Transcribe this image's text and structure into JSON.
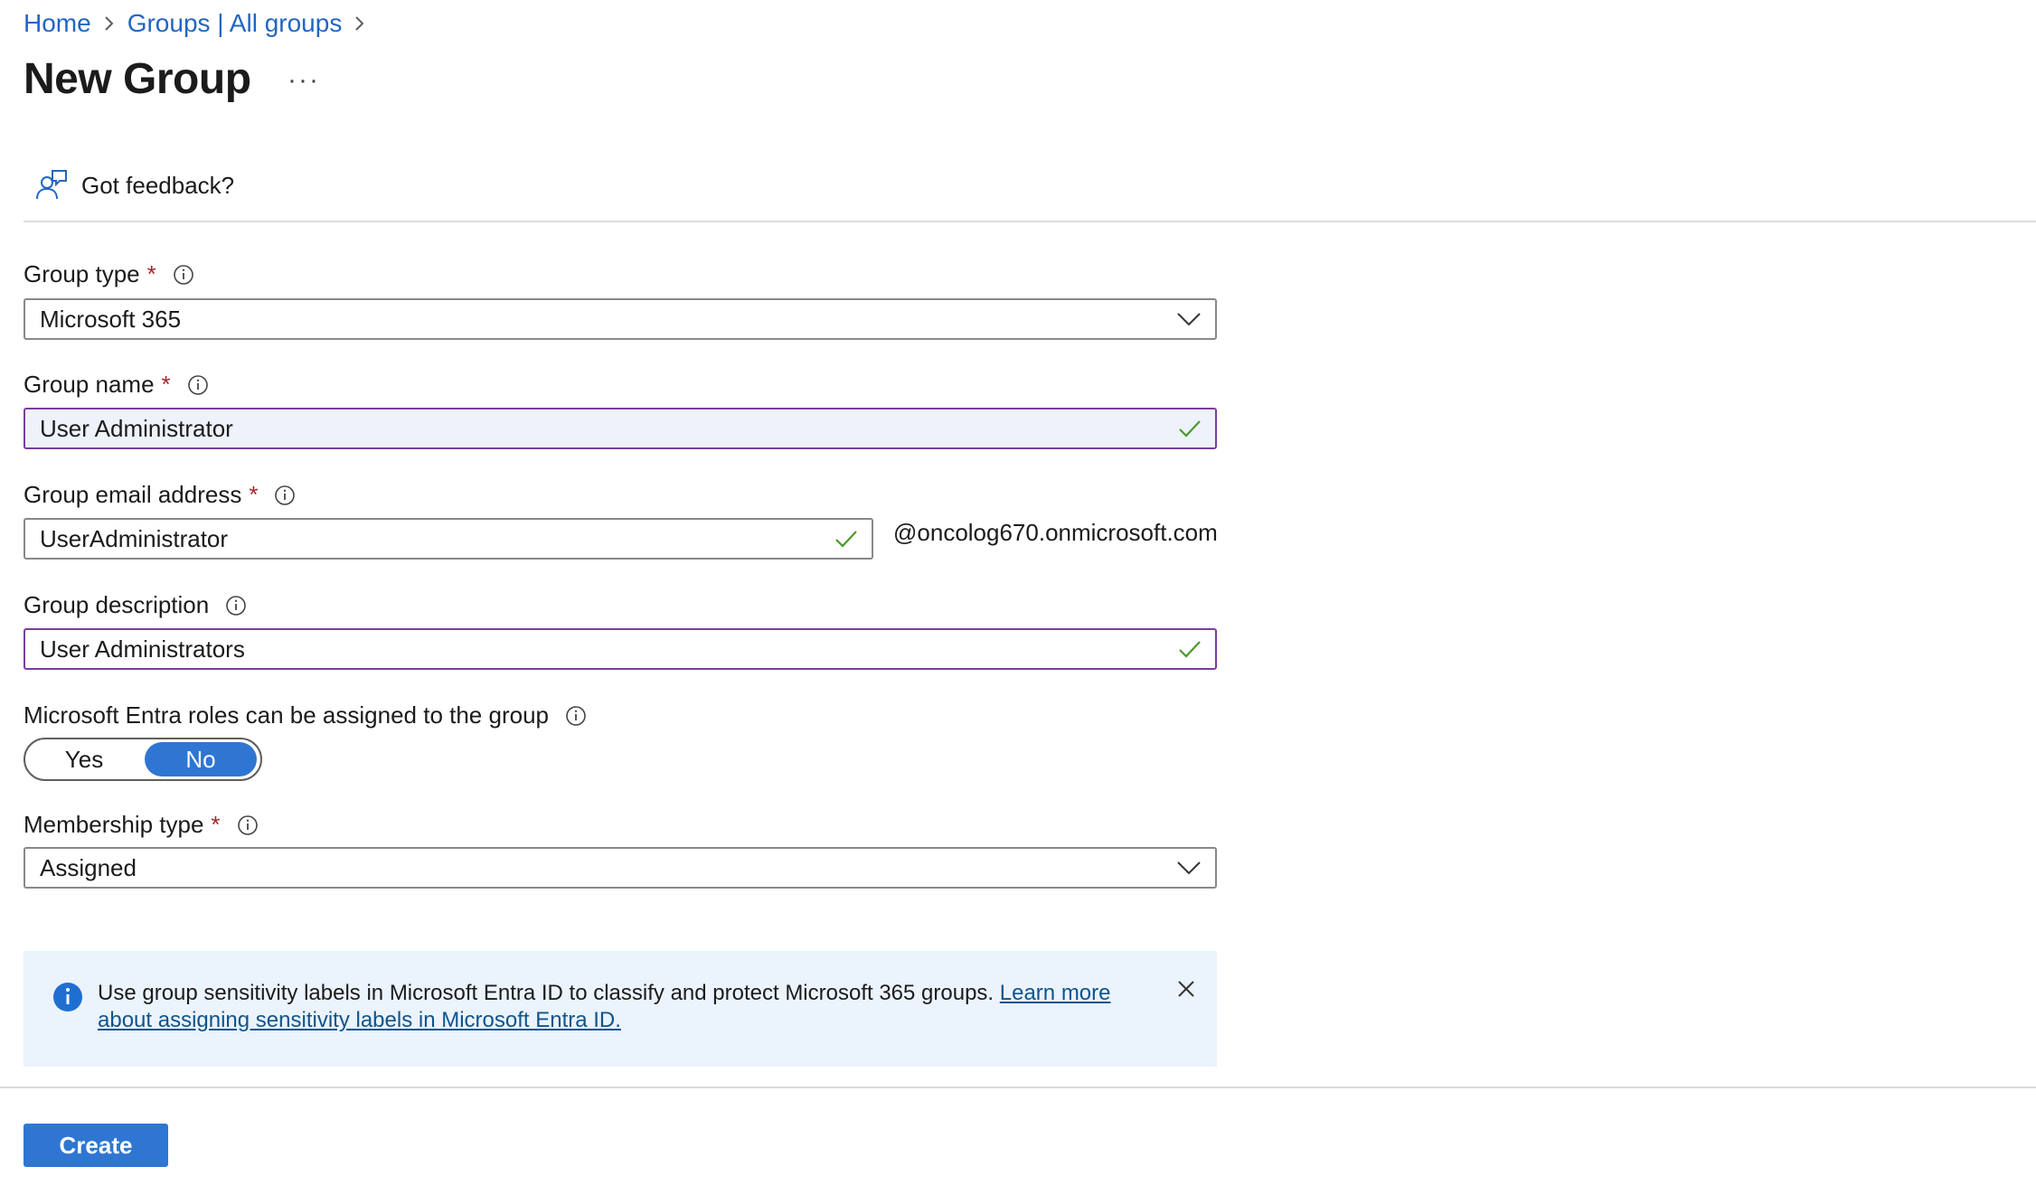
{
  "breadcrumb": {
    "home": "Home",
    "groups": "Groups | All groups"
  },
  "page": {
    "title": "New Group",
    "more": "···"
  },
  "toolbar": {
    "feedback": "Got feedback?"
  },
  "form": {
    "group_type": {
      "label": "Group type",
      "required": "*",
      "value": "Microsoft 365"
    },
    "group_name": {
      "label": "Group name",
      "required": "*",
      "value": "User Administrator"
    },
    "group_email": {
      "label": "Group email address",
      "required": "*",
      "value": "UserAdministrator",
      "suffix": "@oncolog670.onmicrosoft.com"
    },
    "group_description": {
      "label": "Group description",
      "value": "User Administrators"
    },
    "entra_roles": {
      "label": "Microsoft Entra roles can be assigned to the group",
      "yes": "Yes",
      "no": "No",
      "selected": "No"
    },
    "membership_type": {
      "label": "Membership type",
      "required": "*",
      "value": "Assigned"
    }
  },
  "banner": {
    "text": "Use group sensitivity labels in Microsoft Entra ID to classify and protect Microsoft 365 groups.",
    "link": "Learn more about assigning sensitivity labels in Microsoft Entra ID."
  },
  "actions": {
    "create": "Create"
  },
  "colors": {
    "accent": "#2f76d2",
    "link": "#2266c2",
    "focus_border": "#7a3e9d",
    "valid": "#4c9a2a",
    "required": "#a4262c",
    "banner_bg": "#ebf3fc"
  }
}
